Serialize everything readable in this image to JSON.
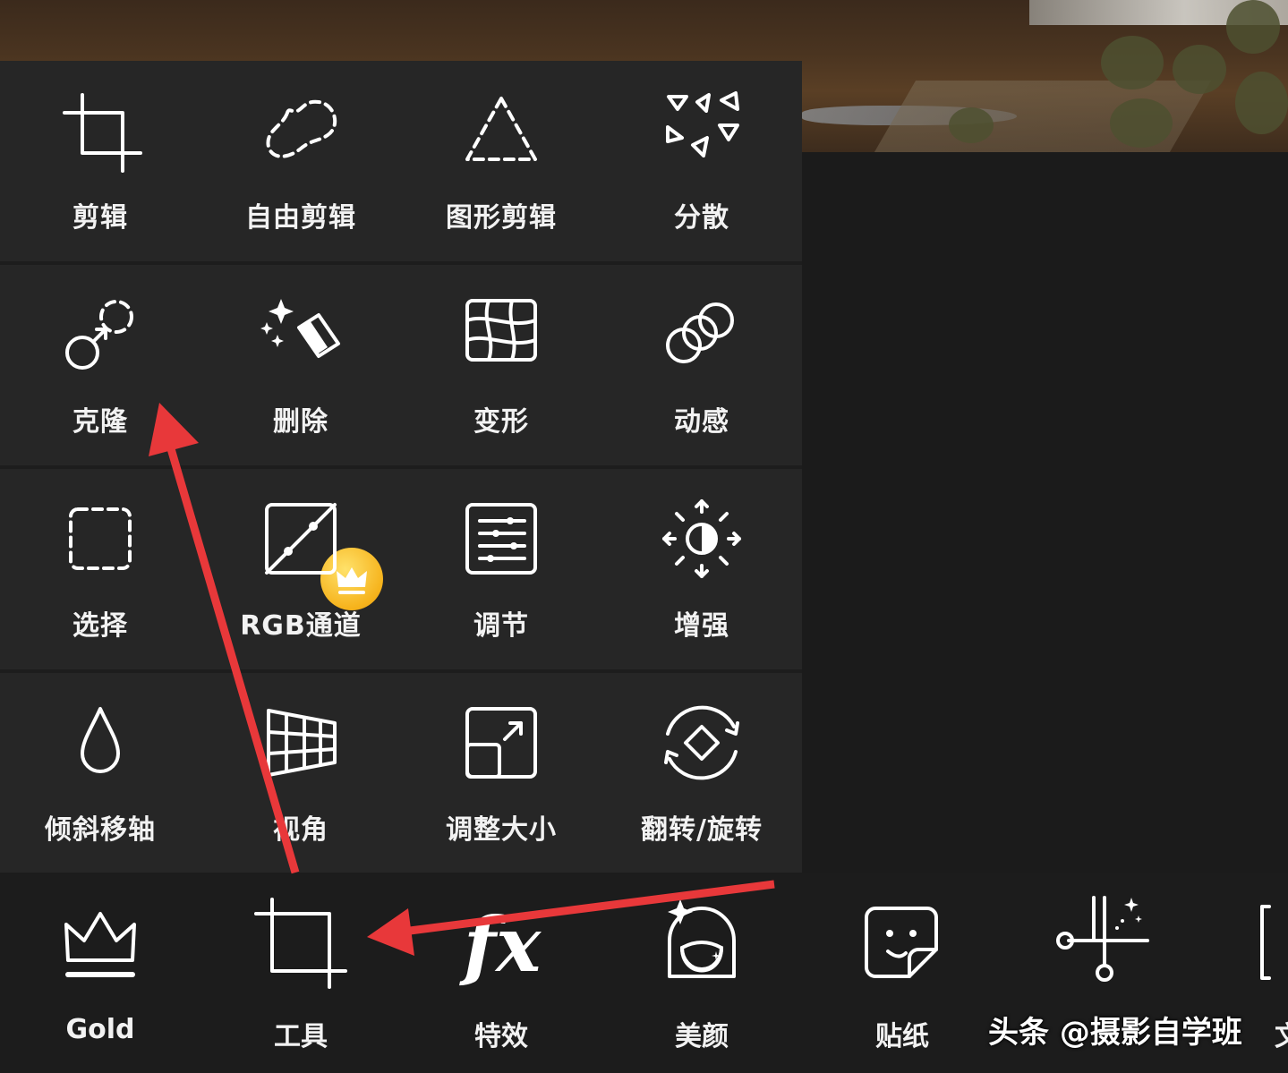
{
  "tools": [
    {
      "id": "crop",
      "label": "剪辑",
      "icon": "crop-icon"
    },
    {
      "id": "free-crop",
      "label": "自由剪辑",
      "icon": "freeform-crop-icon"
    },
    {
      "id": "shape-crop",
      "label": "图形剪辑",
      "icon": "triangle-shape-icon"
    },
    {
      "id": "disperse",
      "label": "分散",
      "icon": "disperse-triangles-icon"
    },
    {
      "id": "clone",
      "label": "克隆",
      "icon": "clone-icon"
    },
    {
      "id": "remove",
      "label": "删除",
      "icon": "eraser-sparkle-icon",
      "premium": true
    },
    {
      "id": "warp",
      "label": "变形",
      "icon": "warp-grid-icon"
    },
    {
      "id": "motion",
      "label": "动感",
      "icon": "motion-circles-icon"
    },
    {
      "id": "select",
      "label": "选择",
      "icon": "selection-icon"
    },
    {
      "id": "rgb",
      "label": "RGB通道",
      "icon": "curve-icon"
    },
    {
      "id": "adjust",
      "label": "调节",
      "icon": "sliders-icon"
    },
    {
      "id": "enhance",
      "label": "增强",
      "icon": "brightness-icon"
    },
    {
      "id": "tilt-shift",
      "label": "倾斜移轴",
      "icon": "droplet-icon"
    },
    {
      "id": "perspective",
      "label": "视角",
      "icon": "perspective-grid-icon"
    },
    {
      "id": "resize",
      "label": "调整大小",
      "icon": "resize-icon"
    },
    {
      "id": "flip-rotate",
      "label": "翻转/旋转",
      "icon": "rotate-icon"
    }
  ],
  "bottom_nav": [
    {
      "id": "gold",
      "label": "Gold",
      "icon": "crown-icon"
    },
    {
      "id": "tools",
      "label": "工具",
      "icon": "crop-icon",
      "active": true
    },
    {
      "id": "effects",
      "label": "特效",
      "icon": "fx-icon"
    },
    {
      "id": "beautify",
      "label": "美颜",
      "icon": "face-icon"
    },
    {
      "id": "stickers",
      "label": "贴纸",
      "icon": "sticker-icon"
    },
    {
      "id": "cutout",
      "label": "",
      "icon": "scissors-sparkle-icon"
    },
    {
      "id": "text",
      "label": "文",
      "icon": "text-frame-icon"
    }
  ],
  "watermark": "头条 @摄影自学班",
  "colors": {
    "panel": "#262626",
    "bar": "#1c1c1c",
    "arrow": "#e8383a",
    "gold": "#f6b31c"
  }
}
